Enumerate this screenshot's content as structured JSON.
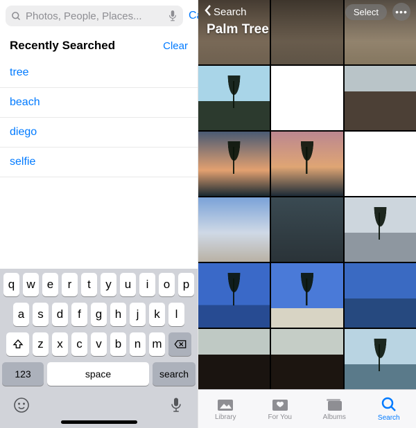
{
  "left": {
    "search": {
      "placeholder": "Photos, People, Places...",
      "value": "",
      "cancel": "Cancel"
    },
    "recent": {
      "title": "Recently Searched",
      "clear": "Clear",
      "items": [
        "tree",
        "beach",
        "diego",
        "selfie"
      ]
    },
    "keyboard": {
      "row1": [
        "q",
        "w",
        "e",
        "r",
        "t",
        "y",
        "u",
        "i",
        "o",
        "p"
      ],
      "row2": [
        "a",
        "s",
        "d",
        "f",
        "g",
        "h",
        "j",
        "k",
        "l"
      ],
      "row3": [
        "z",
        "x",
        "c",
        "v",
        "b",
        "n",
        "m"
      ],
      "numkey": "123",
      "space": "space",
      "action": "search"
    }
  },
  "right": {
    "back_label": "Search",
    "title": "Palm Tree",
    "select_label": "Select",
    "thumbs_count": 18,
    "tabs": {
      "library": "Library",
      "for_you": "For You",
      "albums": "Albums",
      "search": "Search"
    },
    "active_tab": "search"
  }
}
